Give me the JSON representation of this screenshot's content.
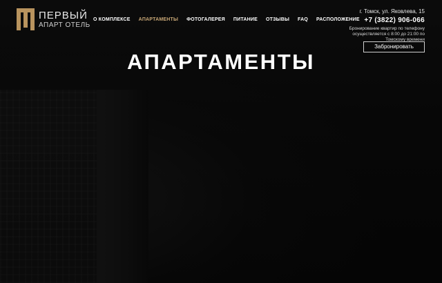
{
  "brand": {
    "name_line1": "ПЕРВЫЙ",
    "name_line2": "АПАРТ ОТЕЛЬ",
    "accent_color": "#c9a877"
  },
  "nav": {
    "items": [
      {
        "label": "О КОМПЛЕКСЕ",
        "active": false
      },
      {
        "label": "АПАРТАМЕНТЫ",
        "active": true
      },
      {
        "label": "ФОТОГАЛЕРЕЯ",
        "active": false
      },
      {
        "label": "ПИТАНИЕ",
        "active": false
      },
      {
        "label": "ОТЗЫВЫ",
        "active": false
      },
      {
        "label": "FAQ",
        "active": false
      },
      {
        "label": "РАСПОЛОЖЕНИЕ",
        "active": false
      }
    ]
  },
  "contact": {
    "address": "г. Томск, ул. Яковлева, 15",
    "phone": "+7 (3822) 906-066",
    "booking_note": "Бронирование квартир по телефону осуществляется с 8:00 до 21:00 по Томскому времени",
    "book_button_label": "Забронировать"
  },
  "hero": {
    "title": "АПАРТАМЕНТЫ"
  }
}
